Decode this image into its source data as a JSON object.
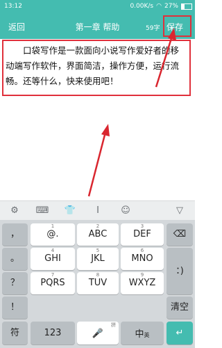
{
  "status": {
    "time": "13:12",
    "net_speed": "0.00K/s",
    "battery": "27%"
  },
  "header": {
    "back": "返回",
    "title": "第一章 帮助",
    "word_count": "59字",
    "save": "保存"
  },
  "editor": {
    "content": "口袋写作是一款面向小说写作爱好者的移动端写作软件，界面简洁，操作方便，运行流畅。还等什么，快来使用吧！"
  },
  "toolbar": {
    "icons": [
      "gear-icon",
      "keyboard-icon",
      "shirt-icon",
      "cursor-move-icon",
      "emoji-icon",
      "collapse-icon"
    ]
  },
  "keyboard": {
    "left_col": [
      "，",
      "。",
      "？",
      "！"
    ],
    "rows": [
      [
        {
          "l": "1",
          "s": "@."
        },
        {
          "l": "2",
          "s": "ABC"
        },
        {
          "l": "3",
          "s": "DEF"
        }
      ],
      [
        {
          "l": "4",
          "s": "GHI"
        },
        {
          "l": "5",
          "s": "JKL"
        },
        {
          "l": "6",
          "s": "MNO"
        }
      ],
      [
        {
          "l": "7",
          "s": "PQRS"
        },
        {
          "l": "8",
          "s": "TUV"
        },
        {
          "l": "9",
          "s": "WXYZ"
        }
      ]
    ],
    "right_col": [
      "⌫",
      "：)",
      "清空"
    ],
    "bottom": {
      "symbol": "符",
      "num": "123",
      "space_hint": "拼",
      "lang": "中",
      "lang_sub": "英",
      "enter": "↵"
    }
  }
}
